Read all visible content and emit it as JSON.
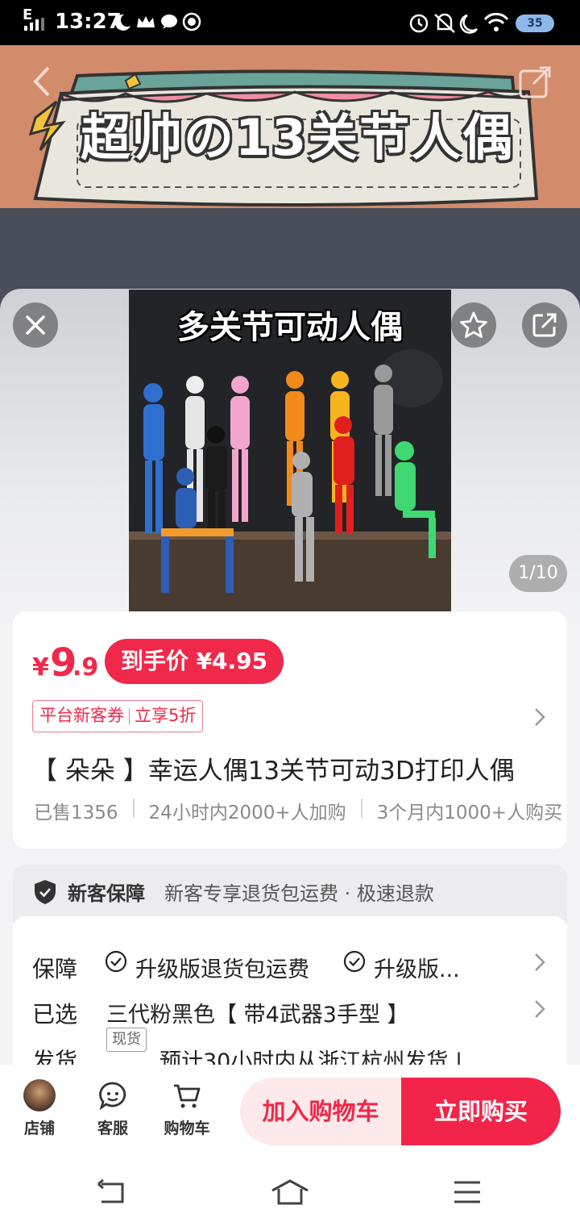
{
  "status_bar": {
    "network": "E",
    "time": "13:27",
    "battery": "35"
  },
  "banner": {
    "title": "超帅の13关节人偶"
  },
  "gallery": {
    "caption": "多关节可动人偶",
    "counter": "1/10"
  },
  "price": {
    "symbol": "¥",
    "integer": "9",
    "decimal": ".9",
    "hand_price": "到手价 ¥4.95"
  },
  "coupon": {
    "part1": "平台新客券",
    "part2": "立享5折"
  },
  "product": {
    "title": "【 朵朵 】幸运人偶13关节可动3D打印人偶",
    "sold": "已售1356",
    "added": "24小时内2000+人加购",
    "bought": "3个月内1000+人购买"
  },
  "guarantee": {
    "title": "新客保障",
    "subtitle": "新客专享退货包运费 · 极速退款"
  },
  "details": {
    "guarantee_label": "保障",
    "guarantee_item1": "升级版退货包运费",
    "guarantee_item2": "升级版...",
    "selected_label": "已选",
    "selected_value": "三代粉黑色【 带4武器3手型 】",
    "ship_label": "发货",
    "ship_tag": "现货",
    "ship_value": "预计30小时内从浙江杭州发货 |"
  },
  "bottom_bar": {
    "shop": "店铺",
    "service": "客服",
    "cart": "购物车",
    "add_to_cart": "加入购物车",
    "buy_now": "立即购买"
  },
  "colors": {
    "accent": "#f0284a",
    "accent_light": "#fde8ea",
    "banner_bg": "#d28b6b"
  }
}
